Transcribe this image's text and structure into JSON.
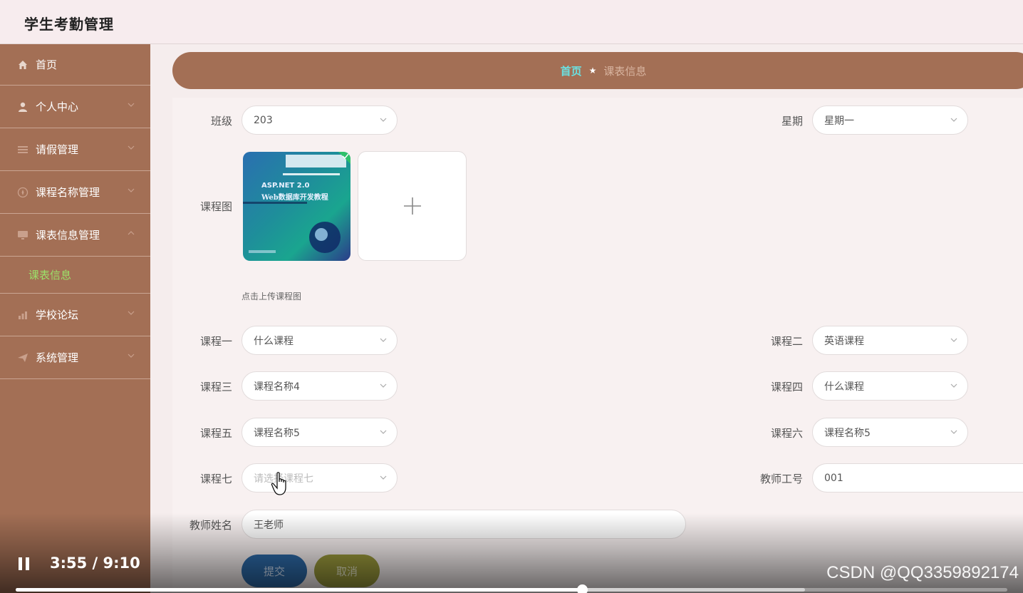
{
  "app": {
    "title": "学生考勤管理"
  },
  "sidebar": {
    "items": [
      {
        "label": "首页",
        "icon": "home-icon"
      },
      {
        "label": "个人中心",
        "icon": "user-icon"
      },
      {
        "label": "请假管理",
        "icon": "list-icon"
      },
      {
        "label": "课程名称管理",
        "icon": "compass-icon"
      },
      {
        "label": "课表信息管理",
        "icon": "monitor-icon"
      },
      {
        "label": "学校论坛",
        "icon": "chart-icon"
      },
      {
        "label": "系统管理",
        "icon": "send-icon"
      }
    ],
    "subitem": {
      "label": "课表信息"
    }
  },
  "breadcrumb": {
    "home": "首页",
    "current": "课表信息"
  },
  "form": {
    "class_label": "班级",
    "class_value": "203",
    "weekday_label": "星期",
    "weekday_value": "星期一",
    "image_label": "课程图",
    "image_hint": "点击上传课程图",
    "course1_label": "课程一",
    "course1_value": "什么课程",
    "course2_label": "课程二",
    "course2_value": "英语课程",
    "course3_label": "课程三",
    "course3_value": "课程名称4",
    "course4_label": "课程四",
    "course4_value": "什么课程",
    "course5_label": "课程五",
    "course5_value": "课程名称5",
    "course6_label": "课程六",
    "course6_value": "课程名称5",
    "course7_label": "课程七",
    "course7_placeholder": "请选择课程七",
    "teacher_id_label": "教师工号",
    "teacher_id_value": "001",
    "teacher_name_label": "教师姓名",
    "teacher_name_value": "王老师",
    "submit_label": "提交",
    "cancel_label": "取消"
  },
  "thumbnail": {
    "title_line1": "ASP.NET 2.0",
    "title_line2": "Web数据库开发教程"
  },
  "video": {
    "time": "3:55 / 9:10",
    "progress_fraction": 0.571,
    "buffered_fraction": 0.796,
    "watermark": "CSDN @QQ3359892174"
  },
  "colors": {
    "sidebar": "#a36f55",
    "active_sub": "#9be26a",
    "crumb_home": "#6be0e0",
    "submit": "#2d6aa8",
    "cancel": "#9b9a3c"
  }
}
